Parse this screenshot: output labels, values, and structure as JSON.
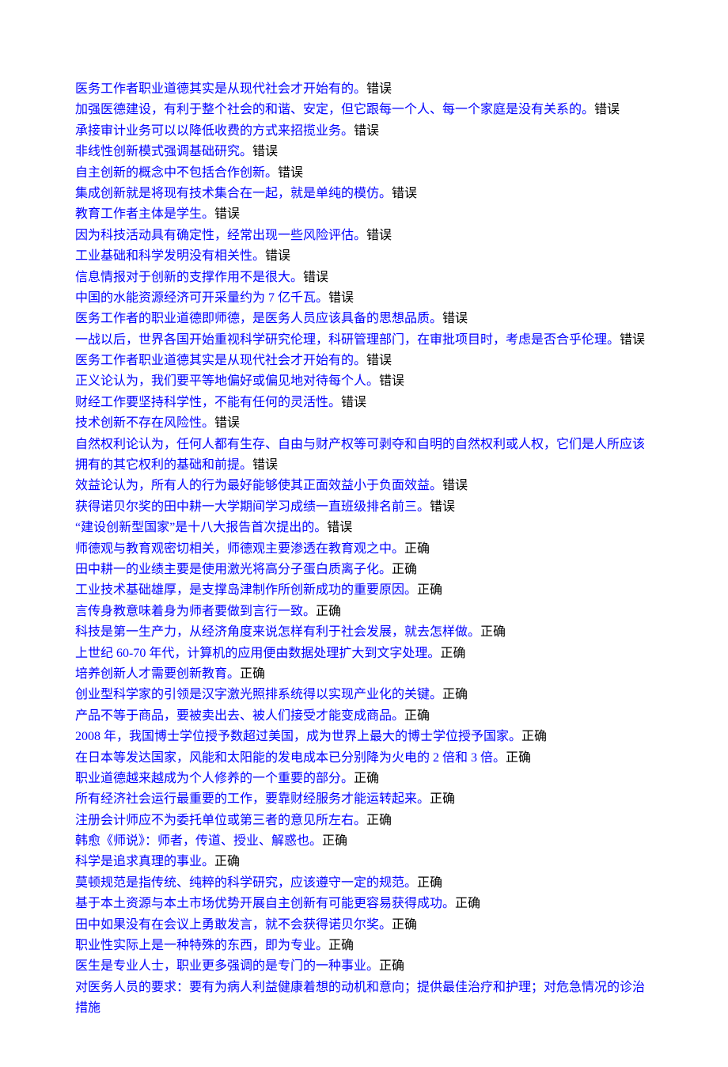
{
  "statements": [
    {
      "text": "医务工作者职业道德其实是从现代社会才开始有的。",
      "answer": "错误"
    },
    {
      "text": "加强医德建设，有利于整个社会的和谐、安定，但它跟每一个人、每一个家庭是没有关系的。",
      "answer": "错误"
    },
    {
      "text": "承接审计业务可以以降低收费的方式来招揽业务。",
      "answer": "错误"
    },
    {
      "text": "非线性创新模式强调基础研究。",
      "answer": "错误"
    },
    {
      "text": "自主创新的概念中不包括合作创新。",
      "answer": "错误"
    },
    {
      "text": "集成创新就是将现有技术集合在一起，就是单纯的模仿。",
      "answer": "错误"
    },
    {
      "text": "教育工作者主体是学生。",
      "answer": "错误"
    },
    {
      "text": "因为科技活动具有确定性，经常出现一些风险评估。",
      "answer": "错误"
    },
    {
      "text": "工业基础和科学发明没有相关性。",
      "answer": "错误"
    },
    {
      "text": "信息情报对于创新的支撑作用不是很大。",
      "answer": "错误"
    },
    {
      "text": "中国的水能资源经济可开采量约为 7 亿千瓦。",
      "answer": "错误"
    },
    {
      "text": "医务工作者的职业道德即师德，是医务人员应该具备的思想品质。",
      "answer": "错误"
    },
    {
      "text": "一战以后，世界各国开始重视科学研究伦理，科研管理部门，在审批项目时，考虑是否合乎伦理。",
      "answer": "错误"
    },
    {
      "text": "医务工作者职业道德其实是从现代社会才开始有的。",
      "answer": "错误"
    },
    {
      "text": "正义论认为，我们要平等地偏好或偏见地对待每个人。",
      "answer": "错误"
    },
    {
      "text": "财经工作要坚持科学性，不能有任何的灵活性。",
      "answer": "错误"
    },
    {
      "text": "技术创新不存在风险性。",
      "answer": "错误"
    },
    {
      "text": "自然权利论认为，任何人都有生存、自由与财产权等可剥夺和自明的自然权利或人权，它们是人所应该拥有的其它权利的基础和前提。",
      "answer": "错误"
    },
    {
      "text": "效益论认为，所有人的行为最好能够使其正面效益小于负面效益。",
      "answer": "错误"
    },
    {
      "text": "获得诺贝尔奖的田中耕一大学期间学习成绩一直班级排名前三。",
      "answer": "错误"
    },
    {
      "text": "“建设创新型国家”是十八大报告首次提出的。",
      "answer": "错误"
    },
    {
      "text": "师德观与教育观密切相关，师德观主要渗透在教育观之中。",
      "answer": "正确"
    },
    {
      "text": "田中耕一的业绩主要是使用激光将高分子蛋白质离子化。",
      "answer": "正确"
    },
    {
      "text": "工业技术基础雄厚，是支撑岛津制作所创新成功的重要原因。",
      "answer": "正确"
    },
    {
      "text": "言传身教意味着身为师者要做到言行一致。",
      "answer": "正确"
    },
    {
      "text": "科技是第一生产力，从经济角度来说怎样有利于社会发展，就去怎样做。",
      "answer": "正确"
    },
    {
      "text": "上世纪 60-70 年代，计算机的应用便由数据处理扩大到文字处理。",
      "answer": "正确"
    },
    {
      "text": "培养创新人才需要创新教育。",
      "answer": "正确"
    },
    {
      "text": "创业型科学家的引领是汉字激光照排系统得以实现产业化的关键。",
      "answer": "正确"
    },
    {
      "text": "产品不等于商品，要被卖出去、被人们接受才能变成商品。",
      "answer": "正确"
    },
    {
      "text": "2008 年，我国博士学位授予数超过美国，成为世界上最大的博士学位授予国家。",
      "answer": "正确"
    },
    {
      "text": "在日本等发达国家，风能和太阳能的发电成本已分别降为火电的 2 倍和 3 倍。",
      "answer": "正确"
    },
    {
      "text": "职业道德越来越成为个人修养的一个重要的部分。",
      "answer": "正确"
    },
    {
      "text": "所有经济社会运行最重要的工作，要靠财经服务才能运转起来。",
      "answer": "正确"
    },
    {
      "text": "注册会计师应不为委托单位或第三者的意见所左右。",
      "answer": "正确"
    },
    {
      "text": "韩愈《师说》：师者，传道、授业、解惑也。",
      "answer": "正确"
    },
    {
      "text": "科学是追求真理的事业。",
      "answer": "正确"
    },
    {
      "text": "莫顿规范是指传统、纯粹的科学研究，应该遵守一定的规范。",
      "answer": "正确"
    },
    {
      "text": "基于本土资源与本土市场优势开展自主创新有可能更容易获得成功。",
      "answer": "正确"
    },
    {
      "text": "田中如果没有在会议上勇敢发言，就不会获得诺贝尔奖。",
      "answer": "正确"
    },
    {
      "text": "职业性实际上是一种特殊的东西，即为专业。",
      "answer": "正确"
    },
    {
      "text": "医生是专业人士，职业更多强调的是专门的一种事业。",
      "answer": "正确"
    },
    {
      "text": "对医务人员的要求：要有为病人利益健康着想的动机和意向；提供最佳治疗和护理；对危急情况的诊治措施",
      "answer": ""
    }
  ]
}
